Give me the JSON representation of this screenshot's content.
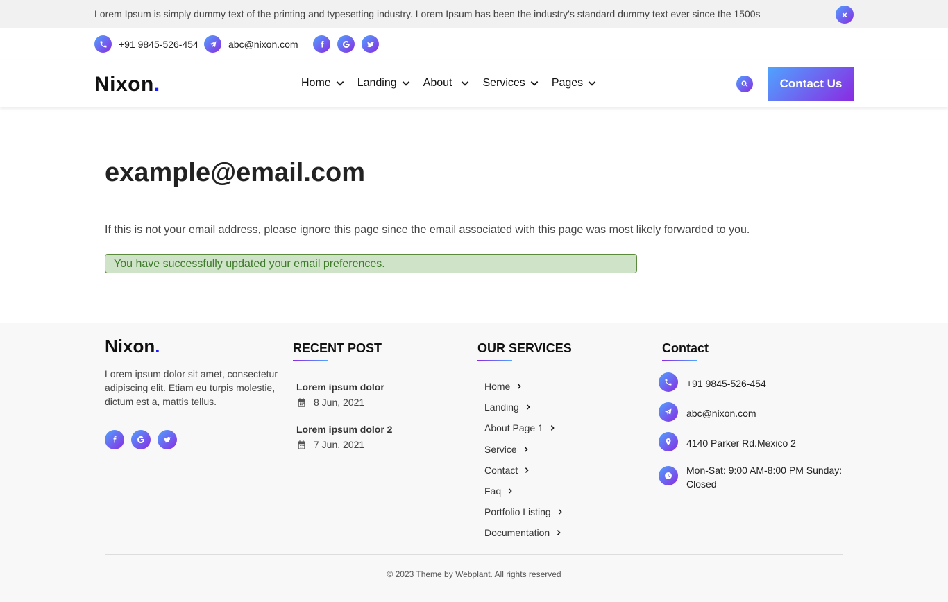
{
  "notice": {
    "text": "Lorem Ipsum is simply dummy text of the printing and typesetting industry. Lorem Ipsum has been the industry's standard dummy text ever since the 1500s",
    "close_label": "×"
  },
  "topbar": {
    "phone": "+91 9845-526-454",
    "email": "abc@nixon.com",
    "social_icons": [
      "facebook-icon",
      "google-icon",
      "twitter-icon"
    ]
  },
  "brand": {
    "name": "Nixon",
    "dot": "."
  },
  "nav": {
    "items": [
      {
        "label": "Home"
      },
      {
        "label": "Landing"
      },
      {
        "label": "About"
      },
      {
        "label": "Services"
      },
      {
        "label": "Pages"
      }
    ],
    "contact_button": "Contact Us"
  },
  "main": {
    "title": "example@email.com",
    "info": "If this is not your email address, please ignore this page since the email associated with this page was most likely forwarded to you.",
    "success": "You have successfully updated your email preferences."
  },
  "footer": {
    "about": "Lorem ipsum dolor sit amet, consectetur adipiscing elit. Etiam eu turpis molestie, dictum est a, mattis tellus.",
    "recent_heading": "RECENT POST",
    "posts": [
      {
        "title": "Lorem ipsum dolor",
        "date": "8 Jun, 2021"
      },
      {
        "title": "Lorem ipsum dolor 2",
        "date": "7 Jun, 2021"
      }
    ],
    "services_heading": "OUR SERVICES",
    "services": [
      "Home",
      "Landing",
      "About Page 1",
      "Service",
      "Contact",
      "Faq",
      "Portfolio Listing",
      "Documentation"
    ],
    "contact_heading": "Contact",
    "contact": {
      "phone": "+91 9845-526-454",
      "email": "abc@nixon.com",
      "address": "4140 Parker Rd.Mexico 2",
      "hours": "Mon-Sat: 9:00 AM-8:00 PM Sunday: Closed"
    },
    "copyright": "© 2023 Theme by Webplant. All rights reserved"
  },
  "colors": {
    "gradient_start": "#4fa3ff",
    "gradient_end": "#8a2be2",
    "success_bg": "#cfe3c8",
    "success_text": "#3d7a29",
    "brand_dot": "#1a1aff"
  }
}
